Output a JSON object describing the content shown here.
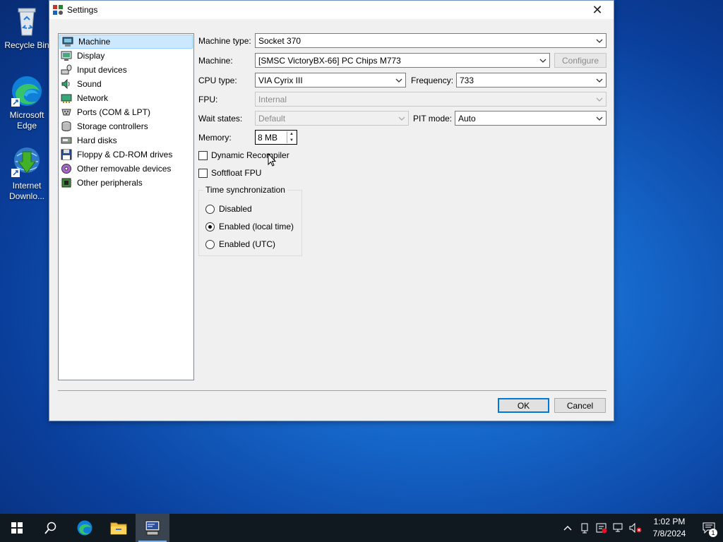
{
  "desktop": {
    "icons": [
      {
        "label": "Recycle Bin"
      },
      {
        "label": "Microsoft Edge"
      },
      {
        "label": "Internet Downlo..."
      }
    ]
  },
  "window": {
    "title": "Settings",
    "close_glyph": "✕"
  },
  "categories": [
    {
      "label": "Machine",
      "icon": "machine-icon",
      "selected": true
    },
    {
      "label": "Display",
      "icon": "display-icon"
    },
    {
      "label": "Input devices",
      "icon": "input-devices-icon"
    },
    {
      "label": "Sound",
      "icon": "sound-icon"
    },
    {
      "label": "Network",
      "icon": "network-icon"
    },
    {
      "label": "Ports (COM & LPT)",
      "icon": "ports-icon"
    },
    {
      "label": "Storage controllers",
      "icon": "storage-icon"
    },
    {
      "label": "Hard disks",
      "icon": "hard-disk-icon"
    },
    {
      "label": "Floppy & CD-ROM drives",
      "icon": "floppy-icon"
    },
    {
      "label": "Other removable devices",
      "icon": "removable-icon"
    },
    {
      "label": "Other peripherals",
      "icon": "peripherals-icon"
    }
  ],
  "form": {
    "machine_type_label": "Machine type:",
    "machine_type_value": "Socket 370",
    "machine_label": "Machine:",
    "machine_value": "[SMSC VictoryBX-66] PC Chips M773",
    "configure_label": "Configure",
    "cpu_type_label": "CPU type:",
    "cpu_type_value": "VIA Cyrix III",
    "frequency_label": "Frequency:",
    "frequency_value": "733",
    "fpu_label": "FPU:",
    "fpu_value": "Internal",
    "wait_states_label": "Wait states:",
    "wait_states_value": "Default",
    "pit_mode_label": "PIT mode:",
    "pit_mode_value": "Auto",
    "memory_label": "Memory:",
    "memory_value": "8 MB",
    "dynamic_recompiler_label": "Dynamic Recompiler",
    "dynamic_recompiler_checked": false,
    "softfloat_label": "Softfloat FPU",
    "softfloat_checked": false,
    "time_sync_title": "Time synchronization",
    "time_sync_options": [
      "Disabled",
      "Enabled (local time)",
      "Enabled (UTC)"
    ],
    "time_sync_selected": "Enabled (local time)"
  },
  "buttons": {
    "ok": "OK",
    "cancel": "Cancel"
  },
  "taskbar": {
    "time": "1:02 PM",
    "date": "7/8/2024",
    "notification_count": "1"
  },
  "colors": {
    "accent": "#0078d7",
    "selection": "#cce8ff",
    "taskbar": "#101820"
  }
}
